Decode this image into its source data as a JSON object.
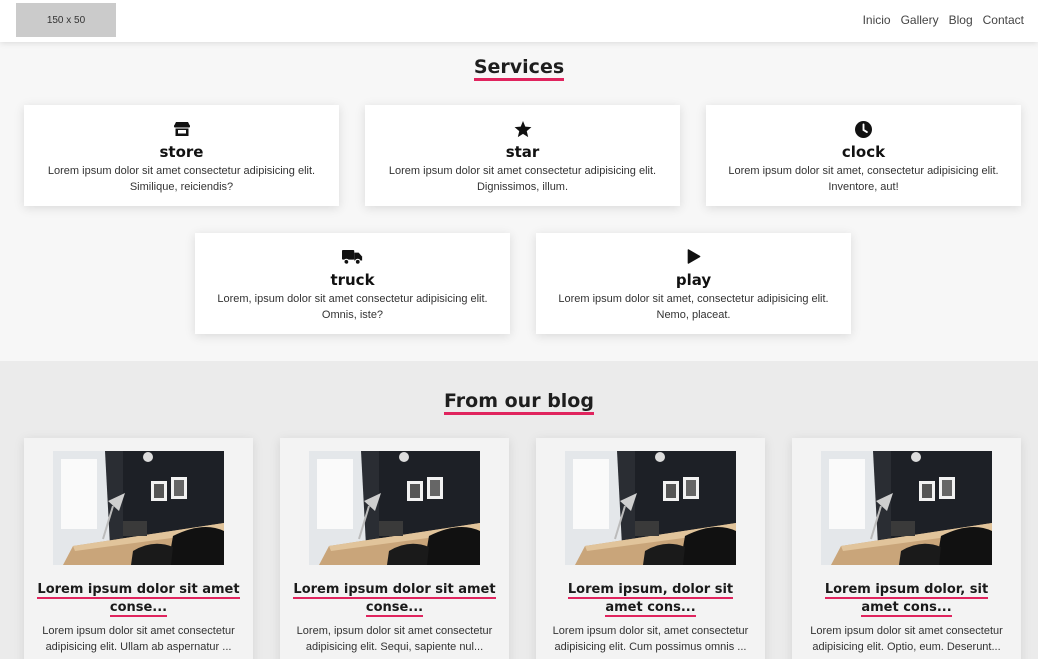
{
  "header": {
    "logo_text": "150 x 50",
    "nav": [
      "Inicio",
      "Gallery",
      "Blog",
      "Contact"
    ]
  },
  "services": {
    "title": "Services",
    "cards": [
      {
        "icon": "store-icon",
        "title": "store",
        "desc": "Lorem ipsum dolor sit amet consectetur adipisicing elit. Similique, reiciendis?"
      },
      {
        "icon": "star-icon",
        "title": "star",
        "desc": "Lorem ipsum dolor sit amet consectetur adipisicing elit. Dignissimos, illum."
      },
      {
        "icon": "clock-icon",
        "title": "clock",
        "desc": "Lorem ipsum dolor sit amet, consectetur adipisicing elit. Inventore, aut!"
      },
      {
        "icon": "truck-icon",
        "title": "truck",
        "desc": "Lorem, ipsum dolor sit amet consectetur adipisicing elit. Omnis, iste?"
      },
      {
        "icon": "play-icon",
        "title": "play",
        "desc": "Lorem ipsum dolor sit amet, consectetur adipisicing elit. Nemo, placeat."
      }
    ]
  },
  "blog": {
    "title": "From our blog",
    "posts": [
      {
        "title": "Lorem ipsum dolor sit amet conse...",
        "desc": "Lorem ipsum dolor sit amet consectetur adipisicing elit. Ullam ab aspernatur ..."
      },
      {
        "title": "Lorem ipsum dolor sit amet conse...",
        "desc": "Lorem, ipsum dolor sit amet consectetur adipisicing elit. Sequi, sapiente nul..."
      },
      {
        "title": "Lorem ipsum, dolor sit amet cons...",
        "desc": "Lorem ipsum dolor sit, amet consectetur adipisicing elit. Cum possimus omnis ..."
      },
      {
        "title": "Lorem ipsum dolor, sit amet cons...",
        "desc": "Lorem ipsum dolor sit amet consectetur adipisicing elit. Optio, eum. Deserunt..."
      }
    ]
  },
  "colors": {
    "accent": "#e0245e"
  }
}
